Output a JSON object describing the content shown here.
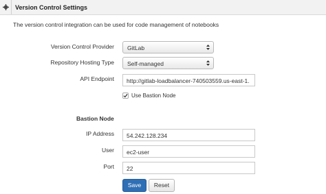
{
  "header": {
    "title": "Version Control Settings",
    "icon": "gear-icon"
  },
  "description": "The version control integration can be used for code management of notebooks",
  "form": {
    "provider": {
      "label": "Version Control Provider",
      "value": "GitLab"
    },
    "hosting": {
      "label": "Repository Hosting Type",
      "value": "Self-managed"
    },
    "endpoint": {
      "label": "API Endpoint",
      "value": "http://gitlab-loadbalancer-740503559.us-east-1."
    },
    "bastion_checkbox": {
      "label": "Use Bastion Node",
      "checked": true
    }
  },
  "bastion": {
    "section_title": "Bastion Node",
    "ip": {
      "label": "IP Address",
      "value": "54.242.128.234"
    },
    "user": {
      "label": "User",
      "value": "ec2-user"
    },
    "port": {
      "label": "Port",
      "value": "22"
    }
  },
  "buttons": {
    "save": "Save",
    "reset": "Reset"
  },
  "colors": {
    "primary_button": "#2f6fb5",
    "header_bg": "#f2f2f2"
  }
}
